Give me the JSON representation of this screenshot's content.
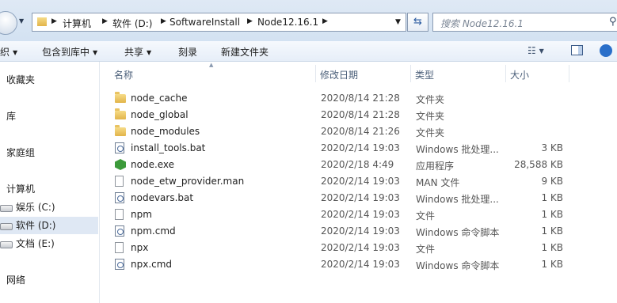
{
  "address": {
    "crumbs": [
      "计算机",
      "软件 (D:)",
      "SoftwareInstall",
      "Node12.16.1"
    ],
    "search_placeholder": "搜索 Node12.16.1"
  },
  "toolbar": {
    "organize": "织",
    "include_in_library": "包含到库中",
    "share": "共享",
    "burn": "刻录",
    "new_folder": "新建文件夹"
  },
  "sidebar": {
    "favorites": "收藏夹",
    "libraries": "库",
    "homegroup": "家庭组",
    "computer": "计算机",
    "drives": [
      "娱乐 (C:)",
      "软件 (D:)",
      "文档 (E:)"
    ],
    "network": "网络"
  },
  "columns": {
    "name": "名称",
    "date": "修改日期",
    "type": "类型",
    "size": "大小"
  },
  "files": [
    {
      "name": "node_cache",
      "date": "2020/8/14 21:28",
      "type": "文件夹",
      "size": "",
      "icon": "folder-icon"
    },
    {
      "name": "node_global",
      "date": "2020/8/14 21:28",
      "type": "文件夹",
      "size": "",
      "icon": "folder-icon"
    },
    {
      "name": "node_modules",
      "date": "2020/8/14 21:26",
      "type": "文件夹",
      "size": "",
      "icon": "folder-icon"
    },
    {
      "name": "install_tools.bat",
      "date": "2020/2/14 19:03",
      "type": "Windows 批处理...",
      "size": "3 KB",
      "icon": "batch-file-icon"
    },
    {
      "name": "node.exe",
      "date": "2020/2/18 4:49",
      "type": "应用程序",
      "size": "28,588 KB",
      "icon": "node-exe-icon"
    },
    {
      "name": "node_etw_provider.man",
      "date": "2020/2/14 19:03",
      "type": "MAN 文件",
      "size": "9 KB",
      "icon": "file-icon"
    },
    {
      "name": "nodevars.bat",
      "date": "2020/2/14 19:03",
      "type": "Windows 批处理...",
      "size": "1 KB",
      "icon": "batch-file-icon"
    },
    {
      "name": "npm",
      "date": "2020/2/14 19:03",
      "type": "文件",
      "size": "1 KB",
      "icon": "file-icon"
    },
    {
      "name": "npm.cmd",
      "date": "2020/2/14 19:03",
      "type": "Windows 命令脚本",
      "size": "1 KB",
      "icon": "cmd-file-icon"
    },
    {
      "name": "npx",
      "date": "2020/2/14 19:03",
      "type": "文件",
      "size": "1 KB",
      "icon": "file-icon"
    },
    {
      "name": "npx.cmd",
      "date": "2020/2/14 19:03",
      "type": "Windows 命令脚本",
      "size": "1 KB",
      "icon": "cmd-file-icon"
    }
  ]
}
